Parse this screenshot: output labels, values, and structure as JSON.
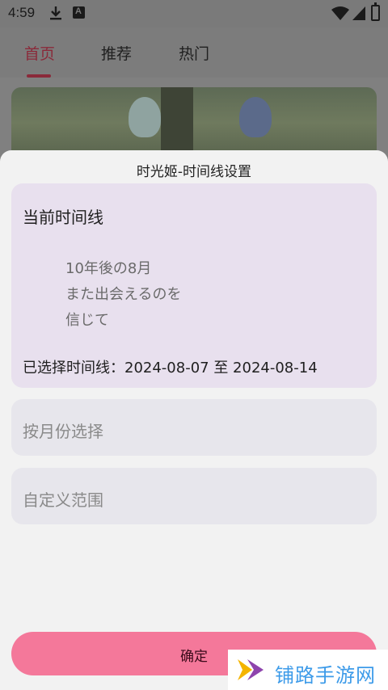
{
  "status_bar": {
    "time": "4:59",
    "icons": [
      "download-icon",
      "a-notification-icon",
      "wifi-icon",
      "signal-icon",
      "battery-icon"
    ]
  },
  "top_tabs": [
    {
      "label": "首页",
      "active": true
    },
    {
      "label": "推荐",
      "active": false
    },
    {
      "label": "热门",
      "active": false
    }
  ],
  "sheet": {
    "title": "时光姬-时间线设置",
    "current": {
      "heading": "当前时间线",
      "quote_lines": [
        "10年後の8月",
        "また出会えるのを",
        "信じて"
      ],
      "selected": "已选择时间线：2024-08-07 至 2024-08-14"
    },
    "options": [
      "按月份选择",
      "自定义范围"
    ],
    "confirm_label": "确定"
  },
  "watermark": {
    "text": "铺路手游网"
  },
  "colors": {
    "accent": "#f4789a",
    "card_current": "#e8e0ee",
    "card_option": "#e7e6ec",
    "watermark_text": "#3d9be9"
  }
}
